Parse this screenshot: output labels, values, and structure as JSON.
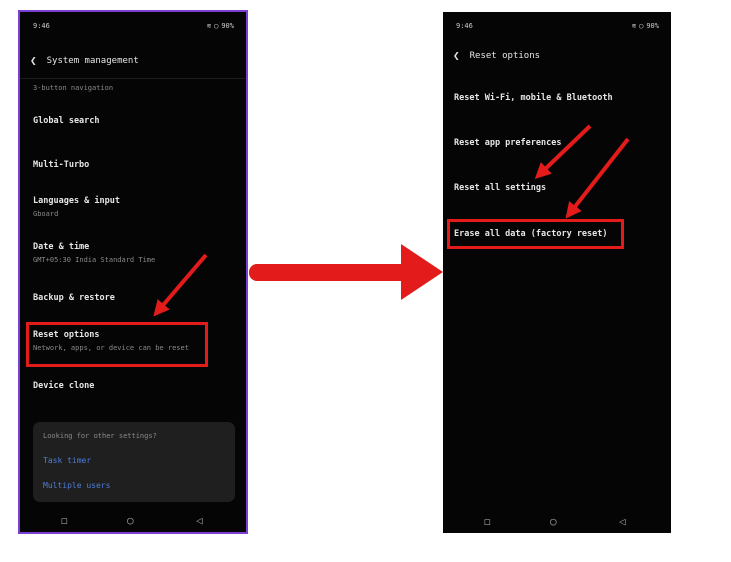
{
  "left_screen": {
    "status_time": "9:46",
    "status_battery": "90%",
    "title": "System management",
    "top_subtitle": "3-button navigation",
    "items": [
      {
        "title": "Global search",
        "subtitle": ""
      },
      {
        "title": "Multi-Turbo",
        "subtitle": ""
      },
      {
        "title": "Languages & input",
        "subtitle": "Gboard"
      },
      {
        "title": "Date & time",
        "subtitle": "GMT+05:30 India Standard Time"
      },
      {
        "title": "Backup & restore",
        "subtitle": ""
      },
      {
        "title": "Reset options",
        "subtitle": "Network, apps, or device can be reset"
      },
      {
        "title": "Device clone",
        "subtitle": ""
      }
    ],
    "card": {
      "heading": "Looking for other settings?",
      "links": [
        "Task timer",
        "Multiple users"
      ]
    }
  },
  "right_screen": {
    "status_time": "9:46",
    "status_battery": "90%",
    "title": "Reset options",
    "items": [
      "Reset Wi-Fi, mobile & Bluetooth",
      "Reset app preferences",
      "Reset all settings",
      "Erase all data (factory reset)"
    ]
  },
  "icons": {
    "back": "chevron-left-icon",
    "nav_recent": "square-icon",
    "nav_home": "circle-icon",
    "nav_back": "triangle-back-icon",
    "wifi": "wifi-icon",
    "battery": "battery-icon"
  },
  "colors": {
    "annotation_red": "#e31b1b",
    "screen_bg": "#050505",
    "link_blue": "#4e7cd9",
    "left_border": "#7b3fd1"
  }
}
